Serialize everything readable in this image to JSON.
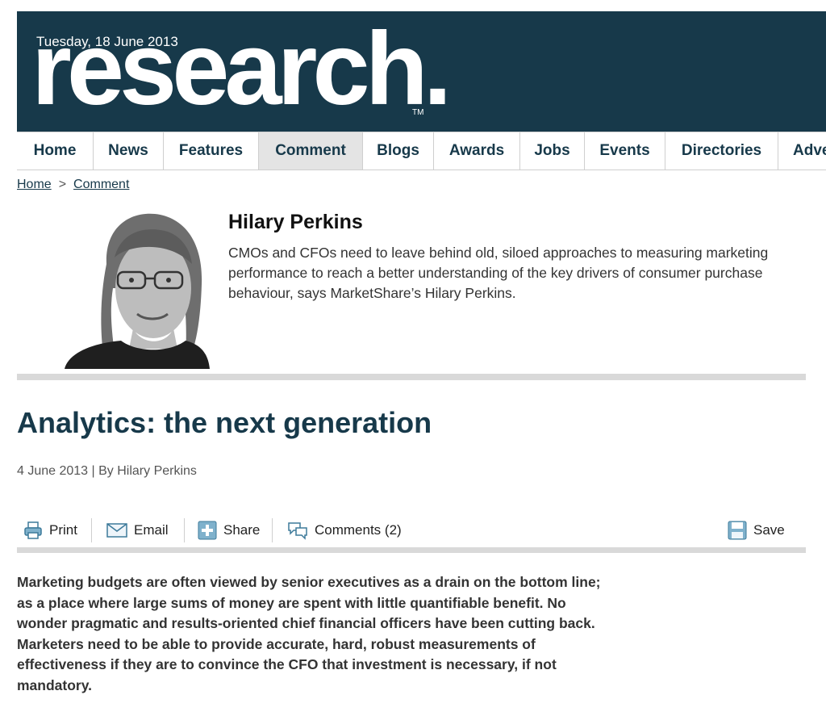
{
  "masthead": {
    "date": "Tuesday, 18 June 2013",
    "logo": "research.",
    "trademark": "TM"
  },
  "nav": {
    "items": [
      {
        "label": "Home",
        "active": false
      },
      {
        "label": "News",
        "active": false
      },
      {
        "label": "Features",
        "active": false
      },
      {
        "label": "Comment",
        "active": true
      },
      {
        "label": "Blogs",
        "active": false
      },
      {
        "label": "Awards",
        "active": false
      },
      {
        "label": "Jobs",
        "active": false
      },
      {
        "label": "Events",
        "active": false
      },
      {
        "label": "Directories",
        "active": false
      },
      {
        "label": "Adve",
        "active": false
      }
    ]
  },
  "breadcrumb": {
    "home": "Home",
    "separator": ">",
    "current": "Comment"
  },
  "author": {
    "name": "Hilary Perkins",
    "blurb": "CMOs and CFOs need to leave behind old, siloed approaches to measuring marketing performance to reach a better understanding of the key drivers of consumer purchase behaviour, says MarketShare’s Hilary Perkins."
  },
  "article": {
    "title": "Analytics: the next generation",
    "byline": "4 June 2013 | By Hilary Perkins",
    "lead": "Marketing budgets are often viewed by senior executives as a drain on the bottom line; as a place where large sums of money are spent with little quantifiable benefit. No wonder pragmatic and results-oriented chief financial officers have been cutting back. Marketers need to be able to provide accurate, hard, robust measurements of effectiveness if they are to convince the CFO that investment is necessary, if not mandatory."
  },
  "toolbar": {
    "print": {
      "label": "Print",
      "icon": "printer-icon"
    },
    "email": {
      "label": "Email",
      "icon": "envelope-icon"
    },
    "share": {
      "label": "Share",
      "icon": "plus-icon"
    },
    "comments": {
      "label": "Comments (2)",
      "icon": "speech-bubble-icon"
    },
    "save": {
      "label": "Save",
      "icon": "floppy-disk-icon"
    }
  },
  "colors": {
    "brand": "#17394a",
    "nav_active": "#e4e4e4",
    "rule": "#d9d9d9"
  }
}
